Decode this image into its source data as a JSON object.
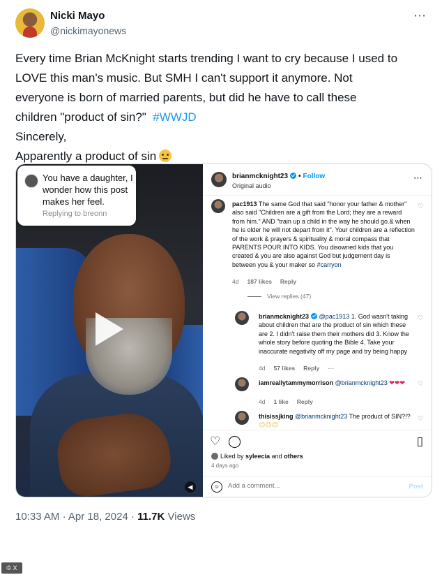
{
  "tweet": {
    "display_name": "Nicki Mayo",
    "handle": "@nickimayonews",
    "more_icon": "⋯",
    "text_lines": [
      "Every time Brian McKnight starts trending I want to cry because I used to",
      "LOVE this man's music. But SMH I can't support it anymore. Not",
      "everyone is born of married parents, but did he have to call these"
    ],
    "text_line4_prefix": "children \"product of sin?\"",
    "hashtag": "#WWJD",
    "signoff": "Sincerely,",
    "signature": "Apparently a product of sin",
    "signature_emoji": "disappointed-face-emoji",
    "time": "10:33 AM",
    "date": "Apr 18, 2024",
    "separator": "·",
    "views_count": "11.7K",
    "views_label": "Views"
  },
  "video": {
    "comment_bubble": {
      "text": "You have a daughter, I wonder how this post makes her feel.",
      "replying": "Replying to breonn"
    },
    "play_icon": "play-icon",
    "mute_icon": "mute-icon",
    "mute_glyph": "◀"
  },
  "instagram": {
    "handle": "brianmcknight23",
    "follow": "Follow",
    "audio": "Original audio",
    "comments": [
      {
        "user": "pac1913",
        "text": " The same God that said \"honor your father & mother\" also said \"Children are a gift from the Lord; they are a reward from him.\" AND \"train up a child in the way he should go.& when he is older he will not depart from it\". Your children are a reflection of the work & prayers & spirituality & moral compass that PARENTS POUR INTO KIDS. You disowned kids that you created & you are also against God but judgement day is between you & your maker so ",
        "mention": "#carryon",
        "age": "4d",
        "likes": "187 likes",
        "reply": "Reply"
      }
    ],
    "view_replies": "View replies (47)",
    "replies": [
      {
        "user": "brianmcknight23",
        "mention": "@pac1913",
        "text": " 1. God wasn't taking about children that are the product of sin which these are 2. I didn't raise them their mothers did 3. Know the whole story before quoting the Bible 4. Take your inaccurate negativity off my page and try being happy",
        "age": "4d",
        "likes": "57 likes",
        "reply": "Reply",
        "more": "⋯"
      },
      {
        "user": "iamreallytammymorrison",
        "mention": "@brianmcknight23",
        "emoji": "❤❤❤",
        "age": "4d",
        "likes": "1 like",
        "reply": "Reply"
      },
      {
        "user": "thisissjking",
        "mention": "@brianmcknight23",
        "text": " The product of SIN?!? ",
        "emoji": "☹☹☹"
      }
    ],
    "liked_by_prefix": "Liked by ",
    "liked_by_user": "syleecia",
    "liked_by_and": " and ",
    "liked_by_others": "others",
    "post_age": "4 days ago",
    "add_comment_placeholder": "Add a comment...",
    "post_button": "Post"
  },
  "badge": "© X",
  "colors": {
    "link_blue": "#1d9bf0",
    "ig_blue": "#0095f6",
    "muted_text": "#536471",
    "border": "#cfd9de"
  }
}
